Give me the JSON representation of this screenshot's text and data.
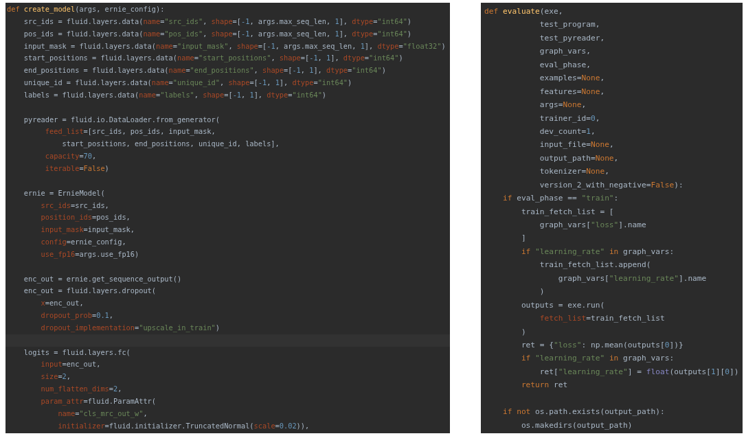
{
  "editors": [
    {
      "lines": [
        {
          "current": false,
          "tokens": [
            {
              "kind": "kw",
              "text": "def "
            },
            {
              "kind": "fn",
              "text": "create_model"
            },
            {
              "kind": "plain",
              "text": "(args, ernie_config):"
            }
          ]
        },
        {
          "current": false,
          "tokens": [
            {
              "kind": "plain",
              "text": "    src_ids = fluid.layers.data("
            },
            {
              "kind": "param",
              "text": "name"
            },
            {
              "kind": "plain",
              "text": "="
            },
            {
              "kind": "str",
              "text": "\"src_ids\""
            },
            {
              "kind": "plain",
              "text": ", "
            },
            {
              "kind": "param",
              "text": "shape"
            },
            {
              "kind": "plain",
              "text": "=["
            },
            {
              "kind": "num",
              "text": "-1"
            },
            {
              "kind": "plain",
              "text": ", args.max_seq_len, "
            },
            {
              "kind": "num",
              "text": "1"
            },
            {
              "kind": "plain",
              "text": "], "
            },
            {
              "kind": "param",
              "text": "dtype"
            },
            {
              "kind": "plain",
              "text": "="
            },
            {
              "kind": "str",
              "text": "\"int64\""
            },
            {
              "kind": "plain",
              "text": ")"
            }
          ]
        },
        {
          "current": false,
          "tokens": [
            {
              "kind": "plain",
              "text": "    pos_ids = fluid.layers.data("
            },
            {
              "kind": "param",
              "text": "name"
            },
            {
              "kind": "plain",
              "text": "="
            },
            {
              "kind": "str",
              "text": "\"pos_ids\""
            },
            {
              "kind": "plain",
              "text": ", "
            },
            {
              "kind": "param",
              "text": "shape"
            },
            {
              "kind": "plain",
              "text": "=["
            },
            {
              "kind": "num",
              "text": "-1"
            },
            {
              "kind": "plain",
              "text": ", args.max_seq_len, "
            },
            {
              "kind": "num",
              "text": "1"
            },
            {
              "kind": "plain",
              "text": "], "
            },
            {
              "kind": "param",
              "text": "dtype"
            },
            {
              "kind": "plain",
              "text": "="
            },
            {
              "kind": "str",
              "text": "\"int64\""
            },
            {
              "kind": "plain",
              "text": ")"
            }
          ]
        },
        {
          "current": false,
          "tokens": [
            {
              "kind": "plain",
              "text": "    input_mask = fluid.layers.data("
            },
            {
              "kind": "param",
              "text": "name"
            },
            {
              "kind": "plain",
              "text": "="
            },
            {
              "kind": "str",
              "text": "\"input_mask\""
            },
            {
              "kind": "plain",
              "text": ", "
            },
            {
              "kind": "param",
              "text": "shape"
            },
            {
              "kind": "plain",
              "text": "=["
            },
            {
              "kind": "num",
              "text": "-1"
            },
            {
              "kind": "plain",
              "text": ", args.max_seq_len, "
            },
            {
              "kind": "num",
              "text": "1"
            },
            {
              "kind": "plain",
              "text": "], "
            },
            {
              "kind": "param",
              "text": "dtype"
            },
            {
              "kind": "plain",
              "text": "="
            },
            {
              "kind": "str",
              "text": "\"float32\""
            },
            {
              "kind": "plain",
              "text": ")"
            }
          ]
        },
        {
          "current": false,
          "tokens": [
            {
              "kind": "plain",
              "text": "    start_positions = fluid.layers.data("
            },
            {
              "kind": "param",
              "text": "name"
            },
            {
              "kind": "plain",
              "text": "="
            },
            {
              "kind": "str",
              "text": "\"start_positions\""
            },
            {
              "kind": "plain",
              "text": ", "
            },
            {
              "kind": "param",
              "text": "shape"
            },
            {
              "kind": "plain",
              "text": "=["
            },
            {
              "kind": "num",
              "text": "-1"
            },
            {
              "kind": "plain",
              "text": ", "
            },
            {
              "kind": "num",
              "text": "1"
            },
            {
              "kind": "plain",
              "text": "], "
            },
            {
              "kind": "param",
              "text": "dtype"
            },
            {
              "kind": "plain",
              "text": "="
            },
            {
              "kind": "str",
              "text": "\"int64\""
            },
            {
              "kind": "plain",
              "text": ")"
            }
          ]
        },
        {
          "current": false,
          "tokens": [
            {
              "kind": "plain",
              "text": "    end_positions = fluid.layers.data("
            },
            {
              "kind": "param",
              "text": "name"
            },
            {
              "kind": "plain",
              "text": "="
            },
            {
              "kind": "str",
              "text": "\"end_positions\""
            },
            {
              "kind": "plain",
              "text": ", "
            },
            {
              "kind": "param",
              "text": "shape"
            },
            {
              "kind": "plain",
              "text": "=["
            },
            {
              "kind": "num",
              "text": "-1"
            },
            {
              "kind": "plain",
              "text": ", "
            },
            {
              "kind": "num",
              "text": "1"
            },
            {
              "kind": "plain",
              "text": "], "
            },
            {
              "kind": "param",
              "text": "dtype"
            },
            {
              "kind": "plain",
              "text": "="
            },
            {
              "kind": "str",
              "text": "\"int64\""
            },
            {
              "kind": "plain",
              "text": ")"
            }
          ]
        },
        {
          "current": false,
          "tokens": [
            {
              "kind": "plain",
              "text": "    unique_id = fluid.layers.data("
            },
            {
              "kind": "param",
              "text": "name"
            },
            {
              "kind": "plain",
              "text": "="
            },
            {
              "kind": "str",
              "text": "\"unique_id\""
            },
            {
              "kind": "plain",
              "text": ", "
            },
            {
              "kind": "param",
              "text": "shape"
            },
            {
              "kind": "plain",
              "text": "=["
            },
            {
              "kind": "num",
              "text": "-1"
            },
            {
              "kind": "plain",
              "text": ", "
            },
            {
              "kind": "num",
              "text": "1"
            },
            {
              "kind": "plain",
              "text": "], "
            },
            {
              "kind": "param",
              "text": "dtype"
            },
            {
              "kind": "plain",
              "text": "="
            },
            {
              "kind": "str",
              "text": "\"int64\""
            },
            {
              "kind": "plain",
              "text": ")"
            }
          ]
        },
        {
          "current": false,
          "tokens": [
            {
              "kind": "plain",
              "text": "    labels = fluid.layers.data("
            },
            {
              "kind": "param",
              "text": "name"
            },
            {
              "kind": "plain",
              "text": "="
            },
            {
              "kind": "str",
              "text": "\"labels\""
            },
            {
              "kind": "plain",
              "text": ", "
            },
            {
              "kind": "param",
              "text": "shape"
            },
            {
              "kind": "plain",
              "text": "=["
            },
            {
              "kind": "num",
              "text": "-1"
            },
            {
              "kind": "plain",
              "text": ", "
            },
            {
              "kind": "num",
              "text": "1"
            },
            {
              "kind": "plain",
              "text": "], "
            },
            {
              "kind": "param",
              "text": "dtype"
            },
            {
              "kind": "plain",
              "text": "="
            },
            {
              "kind": "str",
              "text": "\"int64\""
            },
            {
              "kind": "plain",
              "text": ")"
            }
          ]
        },
        {
          "current": false
        },
        {
          "current": false,
          "tokens": [
            {
              "kind": "plain",
              "text": "    pyreader = fluid.io.DataLoader.from_generator("
            }
          ]
        },
        {
          "current": false,
          "tokens": [
            {
              "kind": "param",
              "text": "         feed_list"
            },
            {
              "kind": "plain",
              "text": "=[src_ids, pos_ids, input_mask,"
            }
          ]
        },
        {
          "current": false,
          "tokens": [
            {
              "kind": "plain",
              "text": "             start_positions, end_positions, unique_id, labels],"
            }
          ]
        },
        {
          "current": false,
          "tokens": [
            {
              "kind": "param",
              "text": "         capacity"
            },
            {
              "kind": "plain",
              "text": "="
            },
            {
              "kind": "num",
              "text": "70"
            },
            {
              "kind": "plain",
              "text": ","
            }
          ]
        },
        {
          "current": false,
          "tokens": [
            {
              "kind": "param",
              "text": "         iterable"
            },
            {
              "kind": "plain",
              "text": "="
            },
            {
              "kind": "kw",
              "text": "False"
            },
            {
              "kind": "plain",
              "text": ")"
            }
          ]
        },
        {
          "current": false
        },
        {
          "current": false,
          "tokens": [
            {
              "kind": "plain",
              "text": "    ernie = ErnieModel("
            }
          ]
        },
        {
          "current": false,
          "tokens": [
            {
              "kind": "param",
              "text": "        src_ids"
            },
            {
              "kind": "plain",
              "text": "=src_ids,"
            }
          ]
        },
        {
          "current": false,
          "tokens": [
            {
              "kind": "param",
              "text": "        position_ids"
            },
            {
              "kind": "plain",
              "text": "=pos_ids,"
            }
          ]
        },
        {
          "current": false,
          "tokens": [
            {
              "kind": "param",
              "text": "        input_mask"
            },
            {
              "kind": "plain",
              "text": "=input_mask,"
            }
          ]
        },
        {
          "current": false,
          "tokens": [
            {
              "kind": "param",
              "text": "        config"
            },
            {
              "kind": "plain",
              "text": "=ernie_config,"
            }
          ]
        },
        {
          "current": false,
          "tokens": [
            {
              "kind": "param",
              "text": "        use_fp16"
            },
            {
              "kind": "plain",
              "text": "=args.use_fp16)"
            }
          ]
        },
        {
          "current": false
        },
        {
          "current": false,
          "tokens": [
            {
              "kind": "plain",
              "text": "    enc_out = ernie.get_sequence_output()"
            }
          ]
        },
        {
          "current": false,
          "tokens": [
            {
              "kind": "plain",
              "text": "    enc_out = fluid.layers.dropout("
            }
          ]
        },
        {
          "current": false,
          "tokens": [
            {
              "kind": "param",
              "text": "        x"
            },
            {
              "kind": "plain",
              "text": "=enc_out,"
            }
          ]
        },
        {
          "current": false,
          "tokens": [
            {
              "kind": "param",
              "text": "        dropout_prob"
            },
            {
              "kind": "plain",
              "text": "="
            },
            {
              "kind": "num",
              "text": "0.1"
            },
            {
              "kind": "plain",
              "text": ","
            }
          ]
        },
        {
          "current": false,
          "tokens": [
            {
              "kind": "param",
              "text": "        dropout_implementation"
            },
            {
              "kind": "plain",
              "text": "="
            },
            {
              "kind": "str",
              "text": "\"upscale_in_train\""
            },
            {
              "kind": "plain",
              "text": ")"
            }
          ]
        },
        {
          "current": true
        },
        {
          "current": false,
          "tokens": [
            {
              "kind": "plain",
              "text": "    logits = fluid.layers.fc("
            }
          ]
        },
        {
          "current": false,
          "tokens": [
            {
              "kind": "param",
              "text": "        input"
            },
            {
              "kind": "plain",
              "text": "=enc_out,"
            }
          ]
        },
        {
          "current": false,
          "tokens": [
            {
              "kind": "param",
              "text": "        size"
            },
            {
              "kind": "plain",
              "text": "="
            },
            {
              "kind": "num",
              "text": "2"
            },
            {
              "kind": "plain",
              "text": ","
            }
          ]
        },
        {
          "current": false,
          "tokens": [
            {
              "kind": "param",
              "text": "        num_flatten_dims"
            },
            {
              "kind": "plain",
              "text": "="
            },
            {
              "kind": "num",
              "text": "2"
            },
            {
              "kind": "plain",
              "text": ","
            }
          ]
        },
        {
          "current": false,
          "tokens": [
            {
              "kind": "param",
              "text": "        param_attr"
            },
            {
              "kind": "plain",
              "text": "=fluid.ParamAttr("
            }
          ]
        },
        {
          "current": false,
          "tokens": [
            {
              "kind": "param",
              "text": "            name"
            },
            {
              "kind": "plain",
              "text": "="
            },
            {
              "kind": "str",
              "text": "\"cls_mrc_out_w\""
            },
            {
              "kind": "plain",
              "text": ","
            }
          ]
        },
        {
          "current": false,
          "tokens": [
            {
              "kind": "param",
              "text": "            initializer"
            },
            {
              "kind": "plain",
              "text": "=fluid.initializer.TruncatedNormal("
            },
            {
              "kind": "param",
              "text": "scale"
            },
            {
              "kind": "plain",
              "text": "="
            },
            {
              "kind": "num",
              "text": "0.02"
            },
            {
              "kind": "plain",
              "text": ")),"
            }
          ]
        }
      ]
    },
    {
      "lines": [
        {
          "current": false,
          "tokens": [
            {
              "kind": "kw",
              "text": "def "
            },
            {
              "kind": "fn",
              "text": "evaluate"
            },
            {
              "kind": "plain",
              "text": "(exe,"
            }
          ]
        },
        {
          "current": false,
          "tokens": [
            {
              "kind": "plain",
              "text": "            test_program,"
            }
          ]
        },
        {
          "current": false,
          "tokens": [
            {
              "kind": "plain",
              "text": "            test_pyreader,"
            }
          ]
        },
        {
          "current": false,
          "tokens": [
            {
              "kind": "plain",
              "text": "            graph_vars,"
            }
          ]
        },
        {
          "current": false,
          "tokens": [
            {
              "kind": "plain",
              "text": "            eval_phase,"
            }
          ]
        },
        {
          "current": false,
          "tokens": [
            {
              "kind": "plain",
              "text": "            examples="
            },
            {
              "kind": "kw",
              "text": "None"
            },
            {
              "kind": "plain",
              "text": ","
            }
          ]
        },
        {
          "current": false,
          "tokens": [
            {
              "kind": "plain",
              "text": "            features="
            },
            {
              "kind": "kw",
              "text": "None"
            },
            {
              "kind": "plain",
              "text": ","
            }
          ]
        },
        {
          "current": false,
          "tokens": [
            {
              "kind": "plain",
              "text": "            args="
            },
            {
              "kind": "kw",
              "text": "None"
            },
            {
              "kind": "plain",
              "text": ","
            }
          ]
        },
        {
          "current": false,
          "tokens": [
            {
              "kind": "plain",
              "text": "            trainer_id="
            },
            {
              "kind": "num",
              "text": "0"
            },
            {
              "kind": "plain",
              "text": ","
            }
          ]
        },
        {
          "current": false,
          "tokens": [
            {
              "kind": "plain",
              "text": "            dev_count="
            },
            {
              "kind": "num",
              "text": "1"
            },
            {
              "kind": "plain",
              "text": ","
            }
          ]
        },
        {
          "current": false,
          "tokens": [
            {
              "kind": "plain",
              "text": "            input_file="
            },
            {
              "kind": "kw",
              "text": "None"
            },
            {
              "kind": "plain",
              "text": ","
            }
          ]
        },
        {
          "current": false,
          "tokens": [
            {
              "kind": "plain",
              "text": "            output_path="
            },
            {
              "kind": "kw",
              "text": "None"
            },
            {
              "kind": "plain",
              "text": ","
            }
          ]
        },
        {
          "current": false,
          "tokens": [
            {
              "kind": "plain",
              "text": "            tokenizer="
            },
            {
              "kind": "kw",
              "text": "None"
            },
            {
              "kind": "plain",
              "text": ","
            }
          ]
        },
        {
          "current": false,
          "tokens": [
            {
              "kind": "plain",
              "text": "            version_2_with_negative="
            },
            {
              "kind": "kw",
              "text": "False"
            },
            {
              "kind": "plain",
              "text": "):"
            }
          ]
        },
        {
          "current": false,
          "tokens": [
            {
              "kind": "kw",
              "text": "    if "
            },
            {
              "kind": "plain",
              "text": "eval_phase == "
            },
            {
              "kind": "str",
              "text": "\"train\""
            },
            {
              "kind": "plain",
              "text": ":"
            }
          ]
        },
        {
          "current": false,
          "tokens": [
            {
              "kind": "plain",
              "text": "        train_fetch_list = ["
            }
          ]
        },
        {
          "current": false,
          "tokens": [
            {
              "kind": "plain",
              "text": "            graph_vars["
            },
            {
              "kind": "str",
              "text": "\"loss\""
            },
            {
              "kind": "plain",
              "text": "].name"
            }
          ]
        },
        {
          "current": false,
          "tokens": [
            {
              "kind": "plain",
              "text": "        ]"
            }
          ]
        },
        {
          "current": false,
          "tokens": [
            {
              "kind": "kw",
              "text": "        if "
            },
            {
              "kind": "str",
              "text": "\"learning_rate\""
            },
            {
              "kind": "kw",
              "text": " in "
            },
            {
              "kind": "plain",
              "text": "graph_vars:"
            }
          ]
        },
        {
          "current": false,
          "tokens": [
            {
              "kind": "plain",
              "text": "            train_fetch_list.append("
            }
          ]
        },
        {
          "current": false,
          "tokens": [
            {
              "kind": "plain",
              "text": "                graph_vars["
            },
            {
              "kind": "str",
              "text": "\"learning_rate\""
            },
            {
              "kind": "plain",
              "text": "].name"
            }
          ]
        },
        {
          "current": false,
          "tokens": [
            {
              "kind": "plain",
              "text": "            )"
            }
          ]
        },
        {
          "current": false,
          "tokens": [
            {
              "kind": "plain",
              "text": "        outputs = exe.run("
            }
          ]
        },
        {
          "current": false,
          "tokens": [
            {
              "kind": "param",
              "text": "            fetch_list"
            },
            {
              "kind": "plain",
              "text": "=train_fetch_list"
            }
          ]
        },
        {
          "current": false,
          "tokens": [
            {
              "kind": "plain",
              "text": "        )"
            }
          ]
        },
        {
          "current": false,
          "tokens": [
            {
              "kind": "plain",
              "text": "        ret = {"
            },
            {
              "kind": "str",
              "text": "\"loss\""
            },
            {
              "kind": "plain",
              "text": ": np.mean(outputs["
            },
            {
              "kind": "num",
              "text": "0"
            },
            {
              "kind": "plain",
              "text": "])}"
            }
          ]
        },
        {
          "current": false,
          "tokens": [
            {
              "kind": "kw",
              "text": "        if "
            },
            {
              "kind": "str",
              "text": "\"learning_rate\""
            },
            {
              "kind": "kw",
              "text": " in "
            },
            {
              "kind": "plain",
              "text": "graph_vars:"
            }
          ]
        },
        {
          "current": false,
          "tokens": [
            {
              "kind": "plain",
              "text": "            ret["
            },
            {
              "kind": "str",
              "text": "\"learning_rate\""
            },
            {
              "kind": "plain",
              "text": "] = "
            },
            {
              "kind": "builtin",
              "text": "float"
            },
            {
              "kind": "plain",
              "text": "(outputs["
            },
            {
              "kind": "num",
              "text": "1"
            },
            {
              "kind": "plain",
              "text": "]["
            },
            {
              "kind": "num",
              "text": "0"
            },
            {
              "kind": "plain",
              "text": "])"
            }
          ]
        },
        {
          "current": false,
          "tokens": [
            {
              "kind": "kw",
              "text": "        return "
            },
            {
              "kind": "plain",
              "text": "ret"
            }
          ]
        },
        {
          "current": false
        },
        {
          "current": false,
          "tokens": [
            {
              "kind": "kw",
              "text": "    if not "
            },
            {
              "kind": "plain",
              "text": "os.path.exists(output_path):"
            }
          ]
        },
        {
          "current": false,
          "tokens": [
            {
              "kind": "plain",
              "text": "        os.makedirs(output_path)"
            }
          ]
        }
      ]
    }
  ]
}
